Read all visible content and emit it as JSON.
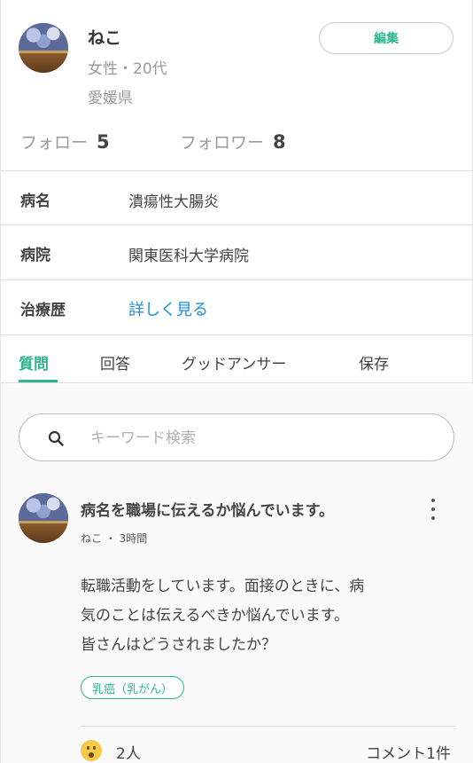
{
  "profile": {
    "name": "ねこ",
    "gender_age": "女性・20代",
    "prefecture": "愛媛県",
    "edit_label": "編集",
    "follow_label": "フォロー",
    "follow_count": "5",
    "follower_label": "フォロワー",
    "follower_count": "8"
  },
  "info": {
    "disease_label": "病名",
    "disease_value": "潰瘍性大腸炎",
    "hospital_label": "病院",
    "hospital_value": "関東医科大学病院",
    "treatment_label": "治療歴",
    "treatment_link": "詳しく見る"
  },
  "tabs": [
    {
      "label": "質問",
      "active": true
    },
    {
      "label": "回答",
      "active": false
    },
    {
      "label": "グッドアンサー",
      "active": false
    },
    {
      "label": "保存",
      "active": false
    }
  ],
  "search": {
    "placeholder": "キーワード検索"
  },
  "post": {
    "title": "病名を職場に伝えるか悩んでいます。",
    "author": "ねこ",
    "time": "3時間",
    "meta": "ねこ ・ 3時間",
    "body_line1": "転職活動をしています。面接のときに、病",
    "body_line2": "気のことは伝えるべきか悩んでいます。",
    "body_line3": "皆さんはどうされましたか？",
    "tag": "乳癌（乳がん）",
    "reaction_icon": "surprised-face-icon",
    "reaction_count": "2人",
    "comment_count": "コメント1件"
  },
  "colors": {
    "accent": "#2fb58e",
    "link": "#1a8fe0",
    "muted": "#9a9a9a"
  }
}
